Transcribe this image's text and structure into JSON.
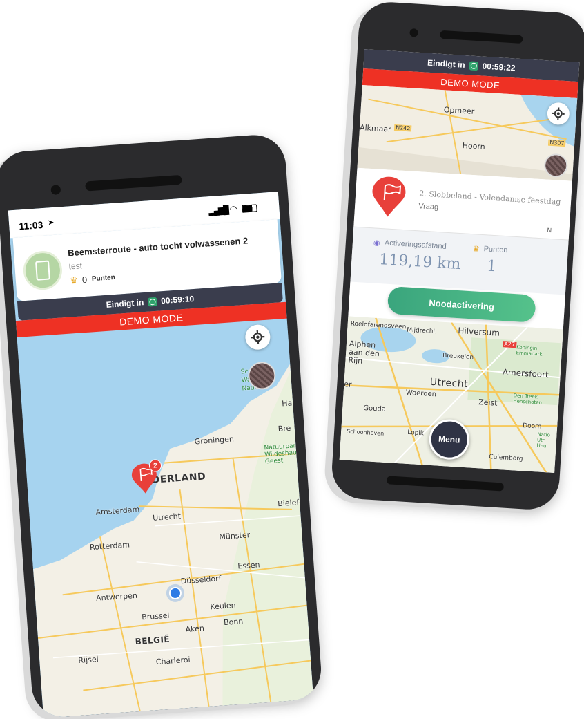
{
  "left_phone": {
    "status": {
      "time": "11:03"
    },
    "card": {
      "title": "Beemsterroute - auto tocht volwassenen 2",
      "subtitle": "test",
      "points_value": "0",
      "points_label": "Punten"
    },
    "timer": {
      "label": "Eindigt in",
      "time": "00:59:10"
    },
    "demo": "DEMO MODE",
    "map_labels": [
      "Groningen",
      "Bre",
      "Natuurpark Wildeshauser Geest",
      "NEDERLAND",
      "Amsterdam",
      "Utrecht",
      "Bielefe",
      "Rotterdam",
      "Münster",
      "Essen",
      "Antwerpen",
      "Düsseldorf",
      "Brussel",
      "Keulen",
      "BELGIË",
      "Aken",
      "Bonn",
      "Charleroi",
      "Rijsel",
      "Ha",
      "Sc",
      "Wa",
      "Natio"
    ],
    "marker_badge": "2"
  },
  "right_phone": {
    "timer": {
      "label": "Eindigt in",
      "time": "00:59:22"
    },
    "demo": "DEMO MODE",
    "top_map_labels": [
      "Opmeer",
      "Alkmaar",
      "Hoorn",
      "N242",
      "N307"
    ],
    "question": {
      "title": "2. Slobbeland - Volendamse feestdag",
      "type": "Vraag",
      "compass": "N"
    },
    "stats": {
      "distance_label": "Activeringsafstand",
      "distance_value": "119,19 km",
      "points_label": "Punten",
      "points_value": "1"
    },
    "emergency_button": "Noodactivering",
    "bottom_map_labels": [
      "Roelofarendsveen",
      "Mijdrecht",
      "Hilversum",
      "A27",
      "Alphen aan den Rijn",
      "Breukelen",
      "Koningin Emmapark",
      "Amersfoort",
      "Utrecht",
      "Woerden",
      "Zeist",
      "Den Treek Henschoten",
      "Gouda",
      "Lopik",
      "Doorn",
      "Schoonhoven",
      "Culemborg",
      "Natio Utr Heu",
      "er"
    ],
    "menu_button": "Menu"
  },
  "colors": {
    "accent_red": "#ee3124",
    "dark_bar": "#3a3d4d",
    "green": "#2fa36b"
  }
}
